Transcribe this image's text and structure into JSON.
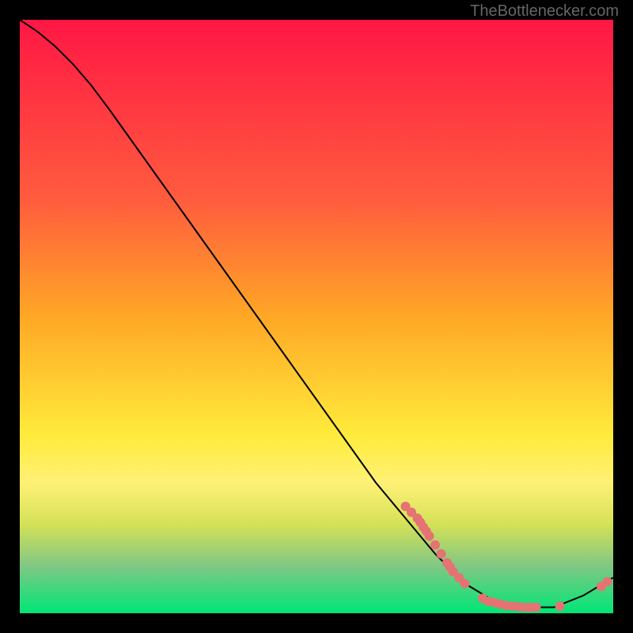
{
  "watermark": "TheBottlenecker.com",
  "chart_data": {
    "type": "line",
    "title": "",
    "xlabel": "",
    "ylabel": "",
    "xlim": [
      0,
      100
    ],
    "ylim": [
      0,
      100
    ],
    "curve": [
      {
        "x": 0,
        "y": 100
      },
      {
        "x": 3,
        "y": 98
      },
      {
        "x": 6,
        "y": 95.5
      },
      {
        "x": 9,
        "y": 92.5
      },
      {
        "x": 12,
        "y": 89
      },
      {
        "x": 15,
        "y": 85
      },
      {
        "x": 20,
        "y": 78
      },
      {
        "x": 25,
        "y": 71
      },
      {
        "x": 30,
        "y": 64
      },
      {
        "x": 35,
        "y": 57
      },
      {
        "x": 40,
        "y": 50
      },
      {
        "x": 45,
        "y": 43
      },
      {
        "x": 50,
        "y": 36
      },
      {
        "x": 55,
        "y": 29
      },
      {
        "x": 60,
        "y": 22
      },
      {
        "x": 65,
        "y": 16
      },
      {
        "x": 70,
        "y": 10
      },
      {
        "x": 75,
        "y": 5
      },
      {
        "x": 80,
        "y": 2
      },
      {
        "x": 85,
        "y": 1
      },
      {
        "x": 90,
        "y": 1
      },
      {
        "x": 95,
        "y": 3
      },
      {
        "x": 100,
        "y": 6
      }
    ],
    "scatter_points": [
      {
        "x": 65,
        "y": 18
      },
      {
        "x": 66,
        "y": 17
      },
      {
        "x": 67,
        "y": 16
      },
      {
        "x": 67.5,
        "y": 15.3
      },
      {
        "x": 68,
        "y": 14.5
      },
      {
        "x": 68.5,
        "y": 13.8
      },
      {
        "x": 69,
        "y": 13
      },
      {
        "x": 70,
        "y": 11.5
      },
      {
        "x": 71,
        "y": 10
      },
      {
        "x": 72,
        "y": 8.5
      },
      {
        "x": 72.5,
        "y": 7.8
      },
      {
        "x": 73,
        "y": 7
      },
      {
        "x": 74,
        "y": 6
      },
      {
        "x": 75,
        "y": 5
      },
      {
        "x": 78,
        "y": 2.5
      },
      {
        "x": 79,
        "y": 2
      },
      {
        "x": 80,
        "y": 1.8
      },
      {
        "x": 81,
        "y": 1.5
      },
      {
        "x": 82,
        "y": 1.3
      },
      {
        "x": 83,
        "y": 1.2
      },
      {
        "x": 84,
        "y": 1.1
      },
      {
        "x": 85,
        "y": 1
      },
      {
        "x": 86,
        "y": 1
      },
      {
        "x": 87,
        "y": 1
      },
      {
        "x": 91,
        "y": 1.2
      },
      {
        "x": 98,
        "y": 4.5
      },
      {
        "x": 99,
        "y": 5.3
      }
    ],
    "gradient_stops": [
      {
        "offset": 0,
        "color": "#ff1744"
      },
      {
        "offset": 30,
        "color": "#ff5b3e"
      },
      {
        "offset": 50,
        "color": "#ffa726"
      },
      {
        "offset": 70,
        "color": "#ffeb3b"
      },
      {
        "offset": 78,
        "color": "#fff176"
      },
      {
        "offset": 85,
        "color": "#d4e157"
      },
      {
        "offset": 92,
        "color": "#81c784"
      },
      {
        "offset": 100,
        "color": "#00e676"
      }
    ],
    "point_color": "#e57373",
    "line_color": "#000000"
  }
}
